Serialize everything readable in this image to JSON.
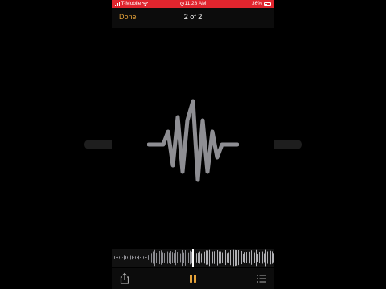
{
  "status_bar": {
    "carrier": "T-Mobile",
    "time": "11:28 AM",
    "battery": "36%",
    "icons": [
      "signal-icon",
      "wifi-icon",
      "alarm-icon",
      "battery-icon"
    ]
  },
  "nav": {
    "done_label": "Done",
    "title": "2 of 2"
  },
  "colors": {
    "status_bar": "#e0252e",
    "accent": "#e5a23a",
    "waveform": "#8e8e93"
  },
  "toolbar": {
    "icons": [
      "share-icon",
      "pause-icon",
      "list-icon"
    ]
  }
}
